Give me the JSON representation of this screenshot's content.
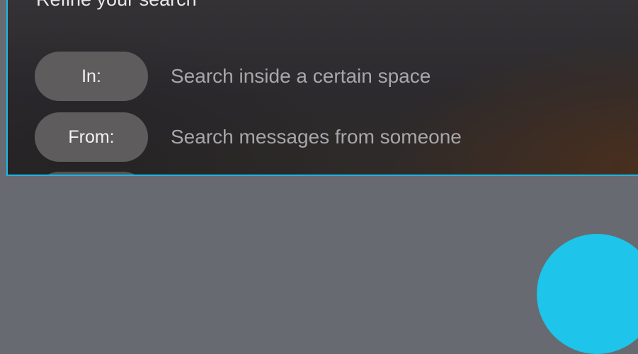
{
  "refine": {
    "title": "Refine your search",
    "filters": [
      {
        "label": "In:",
        "description": "Search inside a certain space"
      },
      {
        "label": "From:",
        "description": "Search messages from someone"
      }
    ]
  },
  "colors": {
    "accent": "#1cb6e3",
    "page_background": "#676b71",
    "pill_background": "#5f5c5d",
    "fab": "#1ec4ea"
  }
}
